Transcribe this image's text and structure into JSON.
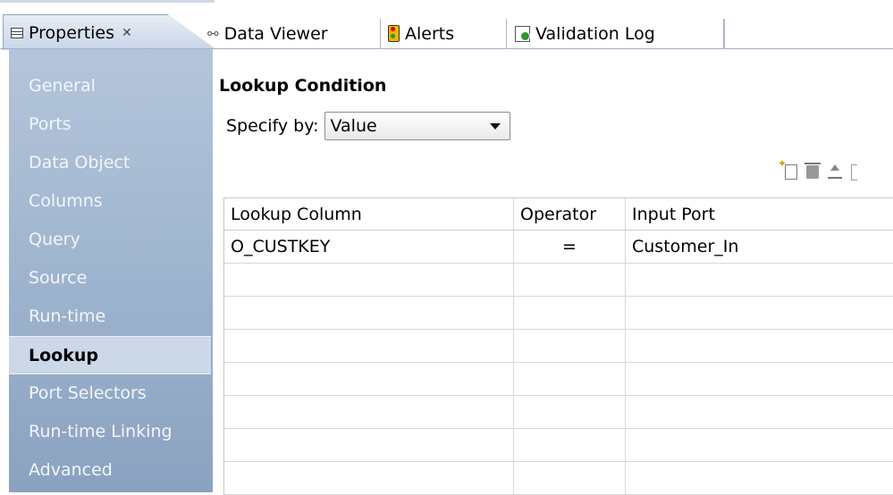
{
  "tabs": [
    {
      "label": "Properties",
      "close_glyph": "✕",
      "icon": "properties-icon",
      "active": true
    },
    {
      "label": "Data Viewer",
      "icon": "data-viewer-icon"
    },
    {
      "label": "Alerts",
      "icon": "traffic-light-icon"
    },
    {
      "label": "Validation Log",
      "icon": "validation-log-icon"
    }
  ],
  "sidebar": {
    "items": [
      {
        "label": "General"
      },
      {
        "label": "Ports"
      },
      {
        "label": "Data Object"
      },
      {
        "label": "Columns"
      },
      {
        "label": "Query"
      },
      {
        "label": "Source"
      },
      {
        "label": "Run-time"
      },
      {
        "label": "Lookup",
        "selected": true
      },
      {
        "label": "Port Selectors"
      },
      {
        "label": "Run-time Linking"
      },
      {
        "label": "Advanced"
      }
    ]
  },
  "main": {
    "section_title": "Lookup Condition",
    "specify_label": "Specify by:",
    "specify_value": "Value",
    "toolbar": [
      "new-icon",
      "delete-icon",
      "move-up-icon",
      "more-icon"
    ],
    "table": {
      "columns": [
        "Lookup Column",
        "Operator",
        "Input Port"
      ],
      "rows": [
        [
          "O_CUSTKEY",
          "=",
          "Customer_In"
        ]
      ]
    }
  },
  "colors": {
    "sidebar_top": "#b4c5db",
    "sidebar_bottom": "#8aa2c0",
    "selected_item": "#ccd8e8",
    "tab_active": "#c9d6e8"
  }
}
